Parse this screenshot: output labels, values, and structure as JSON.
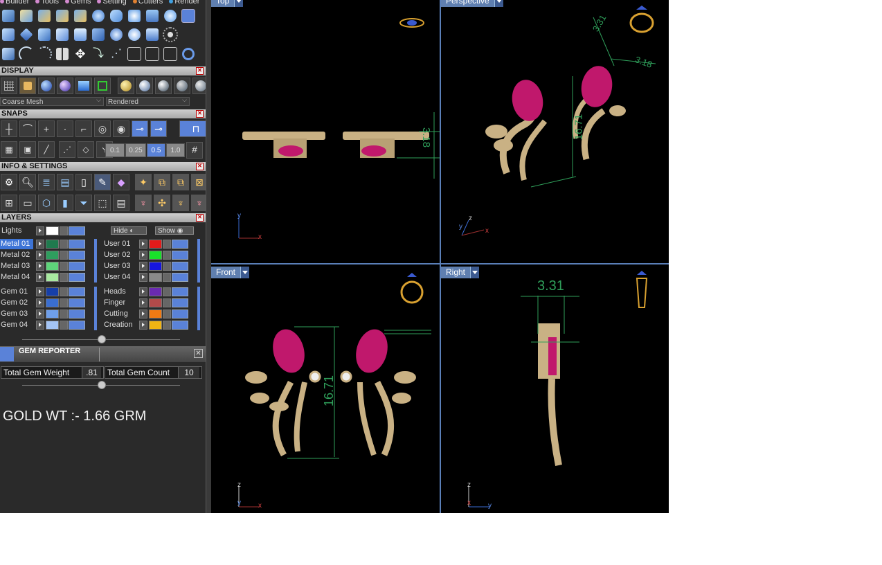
{
  "menu": {
    "items": [
      "Builder",
      "Tools",
      "Gems",
      "Setting",
      "Cutters",
      "Render"
    ]
  },
  "display": {
    "title": "DISPLAY",
    "mesh_select": "Coarse Mesh",
    "render_select": "Rendered"
  },
  "snaps": {
    "title": "SNAPS",
    "increments": [
      "0.1",
      "0.25",
      "0.5",
      "1.0"
    ]
  },
  "info": {
    "title": "INFO & SETTINGS"
  },
  "layers": {
    "title": "LAYERS",
    "lights_label": "Lights",
    "hide_label": "Hide",
    "show_label": "Show",
    "metal": [
      {
        "name": "Metal 01",
        "color": "#1f7a4e"
      },
      {
        "name": "Metal 02",
        "color": "#2e9e5e"
      },
      {
        "name": "Metal 03",
        "color": "#5ed47a"
      },
      {
        "name": "Metal 04",
        "color": "#a8e8a0"
      }
    ],
    "user": [
      {
        "name": "User 01",
        "color": "#e41b1b"
      },
      {
        "name": "User 02",
        "color": "#19e02a"
      },
      {
        "name": "User 03",
        "color": "#1515e0"
      },
      {
        "name": "User 04",
        "color": "#8a8a8a"
      }
    ],
    "gem": [
      {
        "name": "Gem 01",
        "color": "#163fa8"
      },
      {
        "name": "Gem 02",
        "color": "#3a6ed0"
      },
      {
        "name": "Gem 03",
        "color": "#6e9eea"
      },
      {
        "name": "Gem 04",
        "color": "#a4c4f4"
      }
    ],
    "other": [
      {
        "name": "Heads",
        "color": "#6a2ab0"
      },
      {
        "name": "Finger",
        "color": "#b24a4a"
      },
      {
        "name": "Cutting",
        "color": "#f07a14"
      },
      {
        "name": "Creation",
        "color": "#f0b414"
      }
    ]
  },
  "gem_reporter": {
    "title": "GEM REPORTER",
    "weight_label": "Total Gem Weight",
    "weight_value": ".81",
    "count_label": "Total Gem Count",
    "count_value": "10"
  },
  "note": "GOLD WT :- 1.66 GRM",
  "viewports": {
    "top": {
      "label": "Top",
      "dim": "3.18"
    },
    "perspective": {
      "label": "Perspective",
      "dim_a": "3.31",
      "dim_b": "3.18",
      "dim_c": "16.71"
    },
    "front": {
      "label": "Front",
      "dim": "16.71"
    },
    "right": {
      "label": "Right",
      "dim": "3.31"
    }
  },
  "axes": {
    "x": "x",
    "y": "y",
    "z": "z"
  },
  "colors": {
    "accent": "#3d74d6",
    "dim": "#2f9f5a",
    "gold": "#c9b184",
    "ruby": "#c0186c",
    "viewport_border": "#5a7fb8"
  }
}
